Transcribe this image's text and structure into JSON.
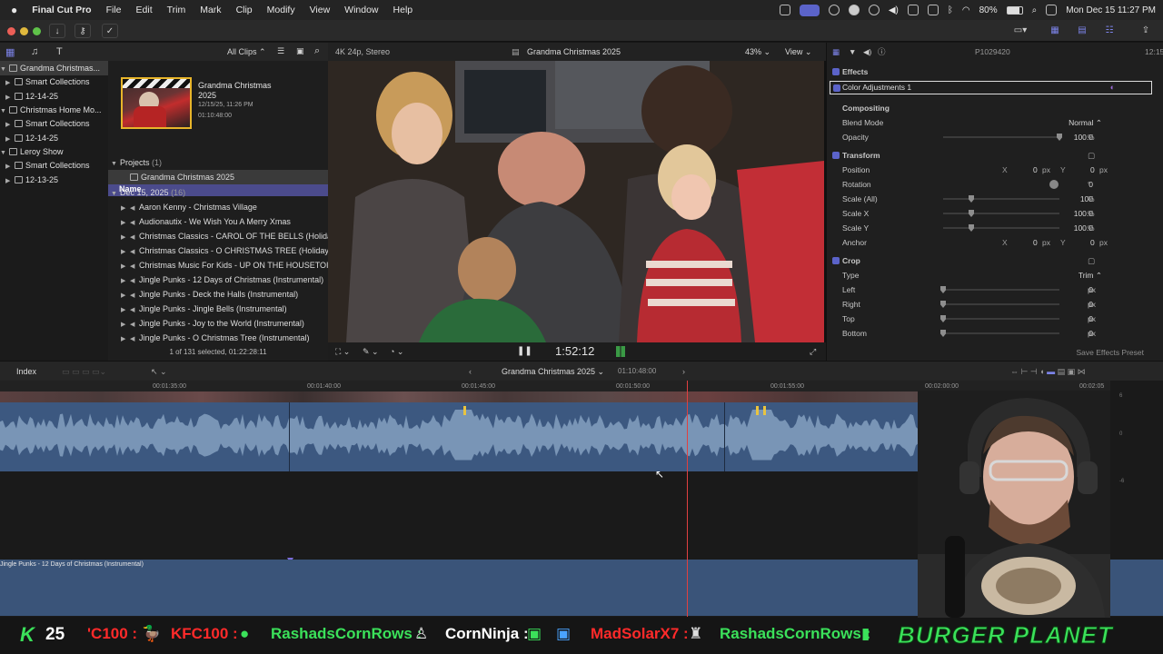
{
  "menubar": {
    "app_name": "Final Cut Pro",
    "items": [
      "File",
      "Edit",
      "Trim",
      "Mark",
      "Clip",
      "Modify",
      "View",
      "Window",
      "Help"
    ],
    "battery": "80%",
    "datetime": "Mon Dec 15  11:27 PM"
  },
  "browser": {
    "filter_label": "All Clips",
    "libraries": [
      {
        "name": "Grandma Christmas...",
        "selected": true
      },
      {
        "name": "Smart Collections",
        "level": 1
      },
      {
        "name": "12-14-25",
        "level": 1
      },
      {
        "name": "Christmas Home Mo...",
        "selected": false
      },
      {
        "name": "Smart Collections",
        "level": 1
      },
      {
        "name": "12-14-25",
        "level": 1
      },
      {
        "name": "Leroy Show",
        "selected": false
      },
      {
        "name": "Smart Collections",
        "level": 1
      },
      {
        "name": "12-13-25",
        "level": 1
      }
    ],
    "thumb": {
      "title": "Grandma Christmas 2025",
      "date": "12/15/25, 11:26 PM",
      "duration": "01:10:48:00"
    },
    "column_header": "Name",
    "projects_label": "Projects",
    "projects_count": "(1)",
    "project_item": "Grandma Christmas 2025",
    "event_label": "Dec 15, 2025",
    "event_count": "(16)",
    "clips": [
      "Aaron Kenny - Christmas Village",
      "Audionautix - We Wish You A Merry Xmas",
      "Christmas Classics - CAROL OF THE BELLS (Holida",
      "Christmas Classics - O CHRISTMAS TREE (Holiday",
      "Christmas Music For Kids - UP ON THE HOUSETOI",
      "Jingle Punks - 12 Days of Christmas (Instrumental)",
      "Jingle Punks - Deck the Halls (Instrumental)",
      "Jingle Punks - Jingle Bells (Instrumental)",
      "Jingle Punks - Joy to the World (Instrumental)",
      "Jingle Punks - O Christmas Tree (Instrumental)"
    ],
    "footer": "1 of 131 selected, 01:22:28:11"
  },
  "viewer": {
    "format": "4K 24p, Stereo",
    "title": "Grandma Christmas 2025",
    "zoom": "43%",
    "view_label": "View",
    "timecode": "1:52:12"
  },
  "inspector": {
    "clip_name": "P1029420",
    "duration": "12:15",
    "effects_label": "Effects",
    "effect_item": "Color Adjustments 1",
    "compositing_label": "Compositing",
    "blend_mode_label": "Blend Mode",
    "blend_mode_value": "Normal",
    "opacity_label": "Opacity",
    "opacity_value": "100.0",
    "opacity_unit": "%",
    "opacity_level": 1.0,
    "transform_label": "Transform",
    "position_label": "Position",
    "position_x": "0",
    "position_y": "0",
    "rotation_label": "Rotation",
    "rotation_value": "0",
    "rotation_unit": "°",
    "scale_all_label": "Scale (All)",
    "scale_all_value": "100",
    "scalex_label": "Scale X",
    "scalex_value": "100.0",
    "scaley_label": "Scale Y",
    "scaley_value": "100.0",
    "anchor_label": "Anchor",
    "anchor_x": "0",
    "anchor_y": "0",
    "crop_label": "Crop",
    "type_label": "Type",
    "type_value": "Trim",
    "left_label": "Left",
    "right_label": "Right",
    "top_label": "Top",
    "bottom_label": "Bottom",
    "crop_value": "0",
    "px": "px",
    "pct": "%",
    "x": "X",
    "y": "Y",
    "save_preset": "Save Effects Preset"
  },
  "timeline": {
    "index_label": "Index",
    "project_name": "Grandma Christmas 2025",
    "project_duration": "01:10:48:00",
    "ruler": [
      "00:01:35:00",
      "00:01:40:00",
      "00:01:45:00",
      "00:01:50:00",
      "00:01:55:00",
      "00:02:00:00",
      "00:02:05"
    ],
    "music_clip": "Jingle Punks - 12 Days of Christmas (Instrumental)",
    "meter_labels": [
      "6",
      "0",
      "-6"
    ]
  },
  "ticker": {
    "score": "25",
    "items": [
      "'C100 :",
      "KFC100 :",
      "RashadsCornRows :",
      "CornNinja :",
      "MadSolarX7 :",
      "RashadsCornRows :"
    ],
    "brand": "BURGER PLANET",
    "colors": {
      "green": "#3be15a",
      "red": "#ff2a2a",
      "white": "#ffffff"
    }
  }
}
